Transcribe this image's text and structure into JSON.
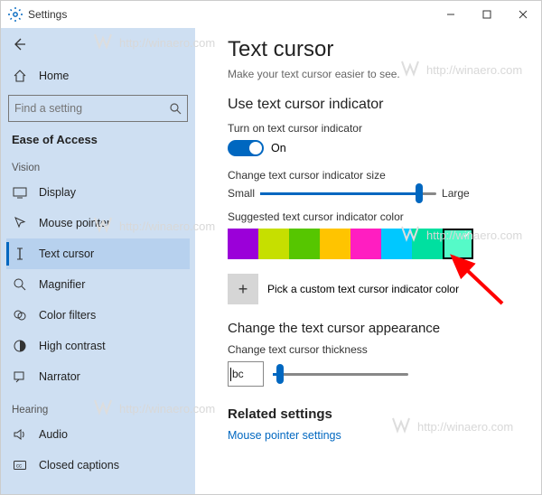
{
  "window": {
    "title": "Settings"
  },
  "sidebar": {
    "home": "Home",
    "search_placeholder": "Find a setting",
    "category": "Ease of Access",
    "groups": {
      "vision": "Vision",
      "hearing": "Hearing"
    },
    "items": {
      "display": "Display",
      "mouse_pointer": "Mouse pointer",
      "text_cursor": "Text cursor",
      "magnifier": "Magnifier",
      "color_filters": "Color filters",
      "high_contrast": "High contrast",
      "narrator": "Narrator",
      "audio": "Audio",
      "closed_captions": "Closed captions"
    }
  },
  "content": {
    "title": "Text cursor",
    "subtitle": "Make your text cursor easier to see.",
    "indicator_heading": "Use text cursor indicator",
    "toggle_label": "Turn on text cursor indicator",
    "toggle_state": "On",
    "size_label": "Change text cursor indicator size",
    "size_small": "Small",
    "size_large": "Large",
    "size_value_pct": 90,
    "suggested_label": "Suggested text cursor indicator color",
    "colors": [
      {
        "hex": "#9b00d9",
        "selected": false
      },
      {
        "hex": "#c6df00",
        "selected": false
      },
      {
        "hex": "#56c600",
        "selected": false
      },
      {
        "hex": "#ffc400",
        "selected": false
      },
      {
        "hex": "#ff1ec1",
        "selected": false
      },
      {
        "hex": "#00c8ff",
        "selected": false
      },
      {
        "hex": "#00e0a0",
        "selected": false
      },
      {
        "hex": "#55fac8",
        "selected": true
      }
    ],
    "custom_label": "Pick a custom text cursor indicator color",
    "appearance_heading": "Change the text cursor appearance",
    "thickness_label": "Change text cursor thickness",
    "thickness_preview": "bc",
    "thickness_value_pct": 5,
    "related_heading": "Related settings",
    "related_link": "Mouse pointer settings"
  },
  "watermark": {
    "text": "http://winaero.com"
  }
}
